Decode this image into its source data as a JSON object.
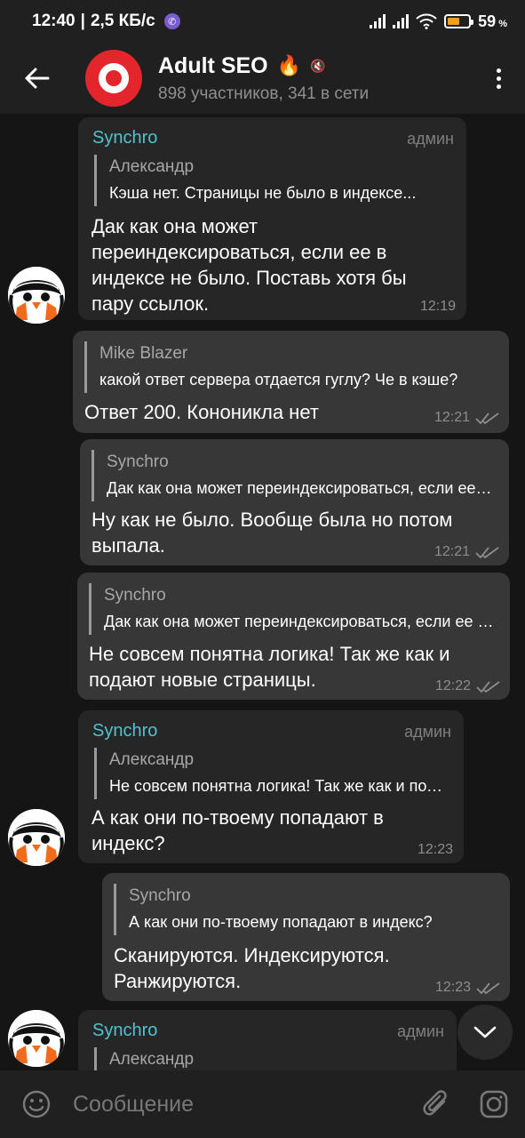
{
  "status_bar": {
    "time": "12:40",
    "speed": "2,5 КБ/с",
    "battery_percent_text": "59",
    "battery_level": 0.59
  },
  "header": {
    "title": "Adult SEO",
    "subtitle": "898 участников, 341 в сети"
  },
  "messages": [
    {
      "sender": "Synchro",
      "role": "админ",
      "quote_name": "Александр",
      "quote_text": "Кэша нет. Страницы не было в индексе...",
      "text": "Дак как она может\nпереиндексироваться, если ее в\nиндексе не было. Поставь хотя бы\nпару ссылок.",
      "time": "12:19"
    },
    {
      "quote_name": "Mike Blazer",
      "quote_text": "какой ответ сервера отдается гуглу? Че в кэше?",
      "text": "Ответ 200. Кононикла нет",
      "time": "12:21"
    },
    {
      "quote_name": "Synchro",
      "quote_text": "Дак как она может переиндексироваться, если ее в индексе не было",
      "text": "Ну как не было. Вообще была но потом\nвыпала.",
      "time": "12:21"
    },
    {
      "quote_name": "Synchro",
      "quote_text": "Дак как она может переиндексироваться, если ее в индексе не было",
      "text": "Не совсем понятна логика! Так же как и\nподают новые страницы.",
      "time": "12:22"
    },
    {
      "sender": "Synchro",
      "role": "админ",
      "quote_name": "Александр",
      "quote_text": "Не совсем понятна логика! Так же как и подают",
      "text": "А как они по-твоему попадают в\nиндекс?",
      "time": "12:23"
    },
    {
      "quote_name": "Synchro",
      "quote_text": "А как они по-твоему попадают в индекс?",
      "text": "Сканируются. Индексируются.\nРанжируются.",
      "time": "12:23"
    },
    {
      "sender": "Synchro",
      "role": "админ",
      "quote_name": "Александр"
    }
  ],
  "input": {
    "placeholder": "Сообщение"
  }
}
